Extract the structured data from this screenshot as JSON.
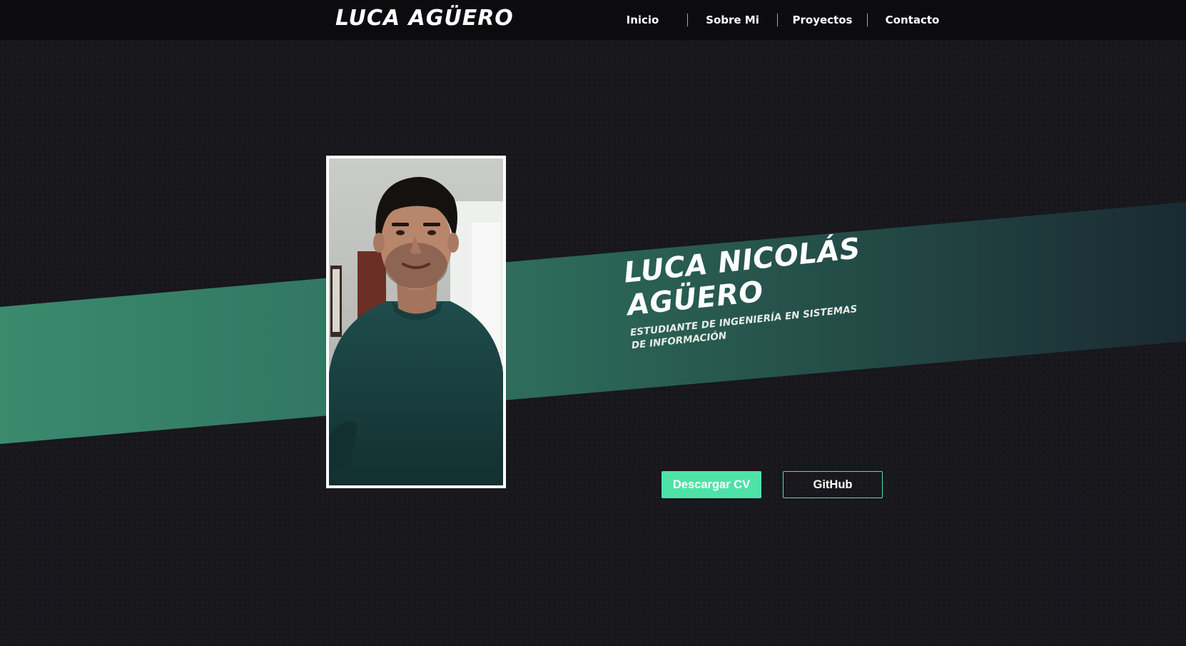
{
  "header": {
    "brand": "LUCA AGÜERO",
    "nav": [
      {
        "label": "Inicio"
      },
      {
        "label": "Sobre Mi"
      },
      {
        "label": "Proyectos"
      },
      {
        "label": "Contacto"
      }
    ]
  },
  "hero": {
    "name": "LUCA NICOLÁS AGÜERO",
    "subtitle": "ESTUDIANTE DE INGENIERÍA EN SISTEMAS DE INFORMACIÓN",
    "photo_icon": "profile-photo",
    "buttons": {
      "cv_label": "Descargar CV",
      "github_label": "GitHub"
    }
  },
  "colors": {
    "background": "#17171c",
    "header": "#0c0c0f",
    "accent": "#4fe2a7",
    "band_start": "#3a8a6e",
    "band_end": "#1a2a32"
  }
}
